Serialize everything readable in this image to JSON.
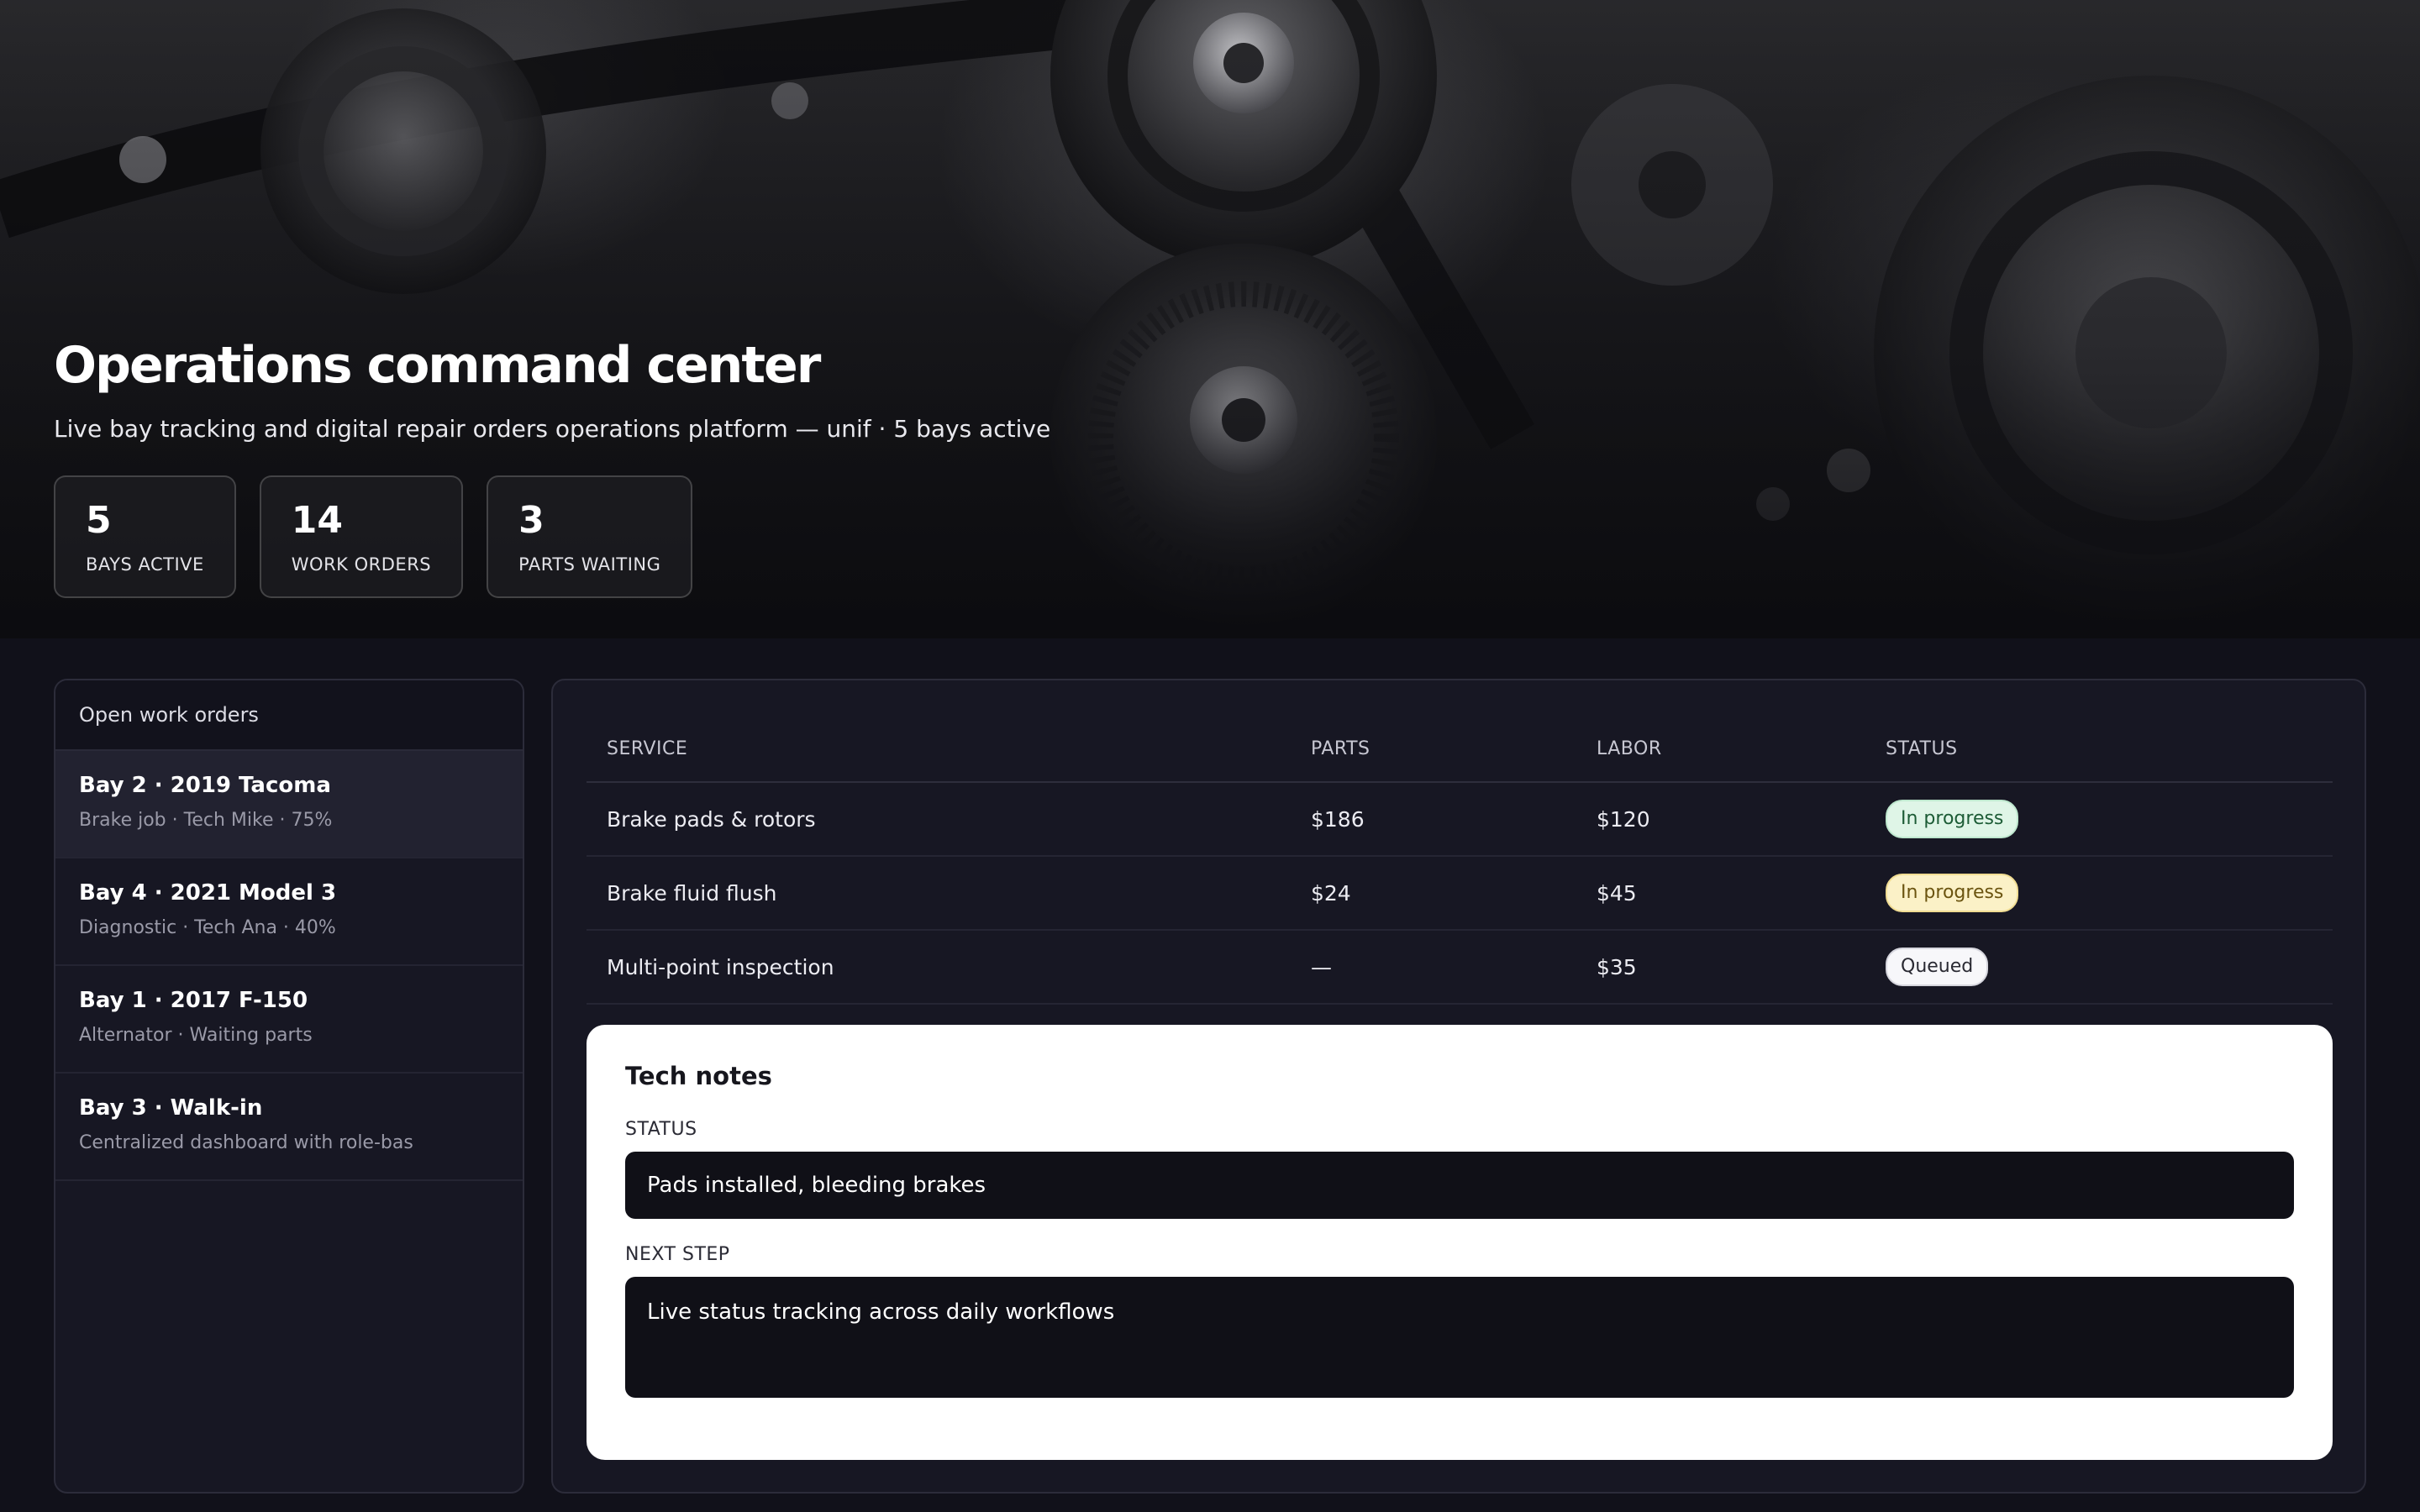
{
  "hero": {
    "title": "Operations command center",
    "subtitle": "Live bay tracking and digital repair orders operations platform — unif · 5 bays active",
    "stats": [
      {
        "value": "5",
        "label": "Bays active"
      },
      {
        "value": "14",
        "label": "Work orders"
      },
      {
        "value": "3",
        "label": "Parts waiting"
      }
    ]
  },
  "sidebar": {
    "header": "Open work orders",
    "orders": [
      {
        "title": "Bay 2 · 2019 Tacoma",
        "meta": "Brake job · Tech Mike · 75%"
      },
      {
        "title": "Bay 4 · 2021 Model 3",
        "meta": "Diagnostic · Tech Ana · 40%"
      },
      {
        "title": "Bay 1 · 2017 F-150",
        "meta": "Alternator · Waiting parts"
      },
      {
        "title": "Bay 3 · Walk-in",
        "meta": "Centralized dashboard with role-bas"
      }
    ]
  },
  "table": {
    "headers": {
      "service": "SERVICE",
      "parts": "PARTS",
      "labor": "LABOR",
      "status": "STATUS"
    },
    "rows": [
      {
        "service": "Brake pads & rotors",
        "parts": "$186",
        "labor": "$120",
        "status": "In progress"
      },
      {
        "service": "Brake fluid flush",
        "parts": "$24",
        "labor": "$45",
        "status": "In progress"
      },
      {
        "service": "Multi-point inspection",
        "parts": "—",
        "labor": "$35",
        "status": "Queued"
      }
    ]
  },
  "notes": {
    "title": "Tech notes",
    "status_label": "STATUS",
    "status_value": "Pads installed, bleeding brakes",
    "next_label": "NEXT STEP",
    "next_value": "Live status tracking across daily workflows"
  },
  "colors": {
    "background": "#11111a",
    "panel": "#171723",
    "badge_green": "#dff5e7",
    "badge_yellow": "#fbf1c7",
    "badge_gray": "#f7f7fa"
  }
}
